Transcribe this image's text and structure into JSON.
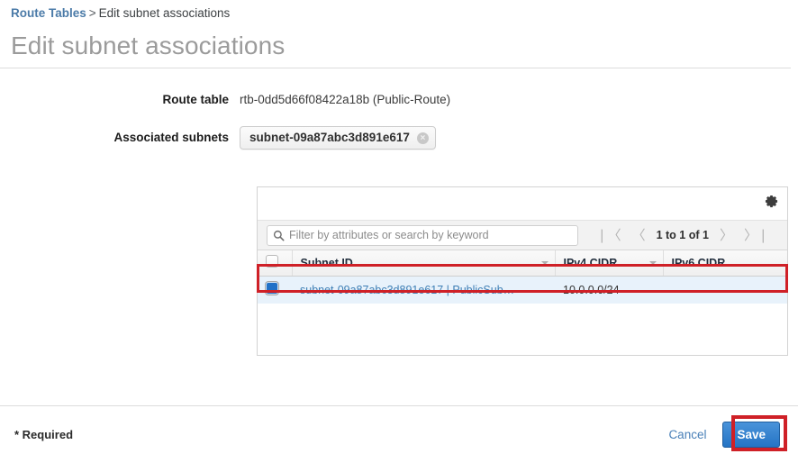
{
  "breadcrumb": {
    "link": "Route Tables",
    "separator": ">",
    "current": "Edit subnet associations"
  },
  "page_title": "Edit subnet associations",
  "form": {
    "route_table_label": "Route table",
    "route_table_value": "rtb-0dd5d66f08422a18b (Public-Route)",
    "associated_subnets_label": "Associated subnets",
    "chips": [
      {
        "text": "subnet-09a87abc3d891e617",
        "remove": "×"
      }
    ]
  },
  "table_panel": {
    "settings_icon": "gear-icon",
    "search": {
      "icon": "search-icon",
      "placeholder": "Filter by attributes or search by keyword",
      "value": ""
    },
    "pager": {
      "first": "❘〈",
      "prev": "〈",
      "count": "1 to 1 of 1",
      "next": "〉",
      "last": "〉❘"
    },
    "columns": [
      "",
      "Subnet ID",
      "IPv4 CIDR",
      "IPv6 CIDR"
    ],
    "rows": [
      {
        "selected": true,
        "subnet_id": "subnet-09a87abc3d891e617 | PublicSub…",
        "ipv4_cidr": "10.0.0.0/24",
        "ipv6_cidr": "-"
      }
    ]
  },
  "footer": {
    "required": "* Required",
    "cancel": "Cancel",
    "save": "Save"
  },
  "colors": {
    "link": "#4b7ba8",
    "title": "#9b9b9b",
    "save_button": "#2574c4",
    "annotation": "#cf2027",
    "row_selected": "#e8f2fb"
  }
}
